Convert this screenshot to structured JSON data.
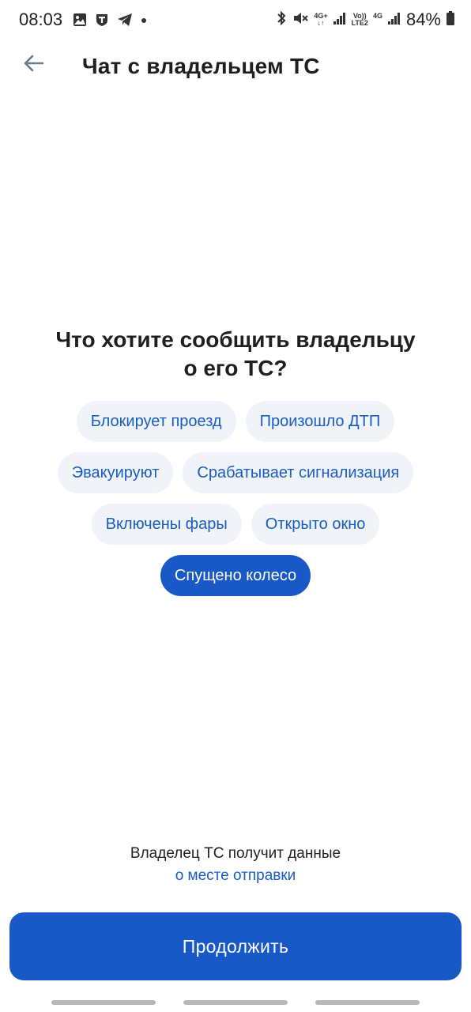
{
  "status_bar": {
    "time": "08:03",
    "battery": "84%",
    "net_top": "4G+",
    "net_volte_top": "Vo))",
    "net_volte_bottom": "LTE2",
    "net_4g": "4G",
    "left_icons": [
      "gallery-icon",
      "t-app-icon",
      "telegram-icon",
      "dot-icon"
    ],
    "right_icons": [
      "bluetooth-icon",
      "mute-icon",
      "signal-icon",
      "signal-icon",
      "battery-icon"
    ]
  },
  "app_bar": {
    "title": "Чат с владельцем ТС",
    "back_icon": "arrow-back-icon"
  },
  "question": {
    "line1": "Что хотите сообщить владельцу",
    "line2": "о его ТС?"
  },
  "chips": {
    "rows": [
      [
        {
          "label": "Блокирует проезд",
          "selected": false
        },
        {
          "label": "Произошло ДТП",
          "selected": false
        }
      ],
      [
        {
          "label": "Эвакуируют",
          "selected": false
        },
        {
          "label": "Срабатывает сигнализация",
          "selected": false
        }
      ],
      [
        {
          "label": "Включены фары",
          "selected": false
        },
        {
          "label": "Открыто окно",
          "selected": false
        }
      ],
      [
        {
          "label": "Спущено колесо",
          "selected": true
        }
      ]
    ]
  },
  "footer": {
    "note": "Владелец ТС получит данные",
    "link": "о месте отправки",
    "continue_label": "Продолжить"
  },
  "colors": {
    "accent": "#1858c7",
    "chip_bg": "#f0f3f8",
    "link": "#1a5dc0",
    "back_arrow": "#6b7a90"
  }
}
